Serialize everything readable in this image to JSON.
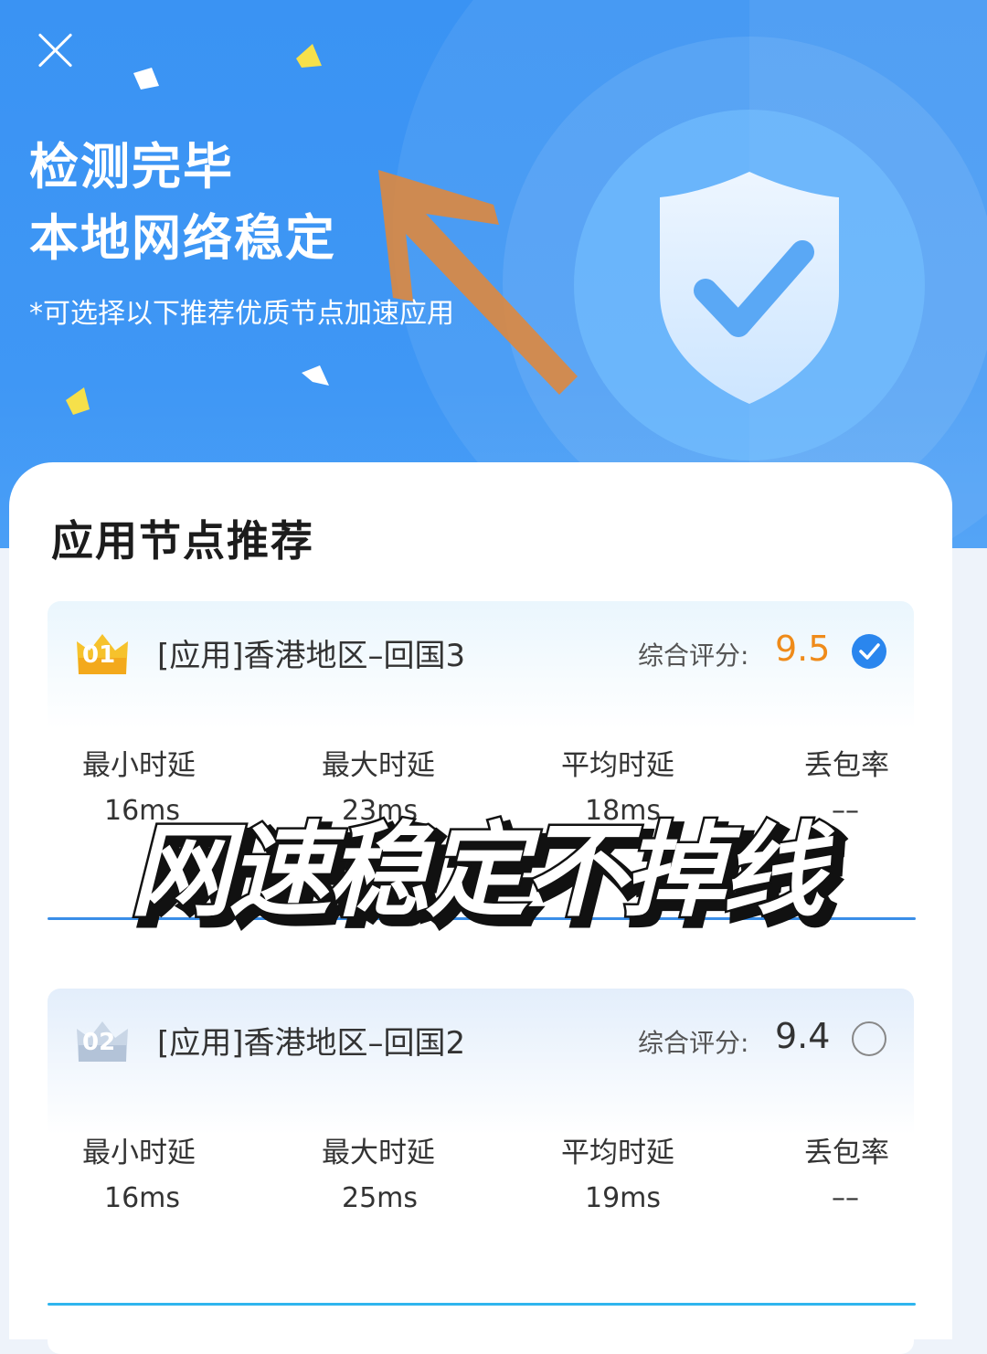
{
  "header": {
    "title_line1": "检测完毕",
    "title_line2": "本地网络稳定",
    "subtitle": "*可选择以下推荐优质节点加速应用"
  },
  "icons": {
    "close": "close-icon",
    "shield": "shield-check-icon",
    "selected": "check-circle-icon",
    "unselected": "empty-circle-icon"
  },
  "panel": {
    "title": "应用节点推荐",
    "nodes": [
      {
        "rank": "01",
        "name": "[应用]香港地区–回国3",
        "score_label": "综合评分:",
        "score": "9.5",
        "selected": true,
        "stats": [
          {
            "label": "最小时延",
            "value": "16ms"
          },
          {
            "label": "最大时延",
            "value": "23ms"
          },
          {
            "label": "平均时延",
            "value": "18ms"
          },
          {
            "label": "丢包率",
            "value": "––"
          }
        ]
      },
      {
        "rank": "02",
        "name": "[应用]香港地区–回国2",
        "score_label": "综合评分:",
        "score": "9.4",
        "selected": false,
        "stats": [
          {
            "label": "最小时延",
            "value": "16ms"
          },
          {
            "label": "最大时延",
            "value": "25ms"
          },
          {
            "label": "平均时延",
            "value": "19ms"
          },
          {
            "label": "丢包率",
            "value": "––"
          }
        ]
      }
    ]
  },
  "overlay_caption": "网速稳定不掉线",
  "colors": {
    "hero_blue": "#3f97f5",
    "accent_blue": "#2a86ee",
    "score_orange": "#ef8b1a",
    "annotation_arrow": "#e0883a"
  }
}
